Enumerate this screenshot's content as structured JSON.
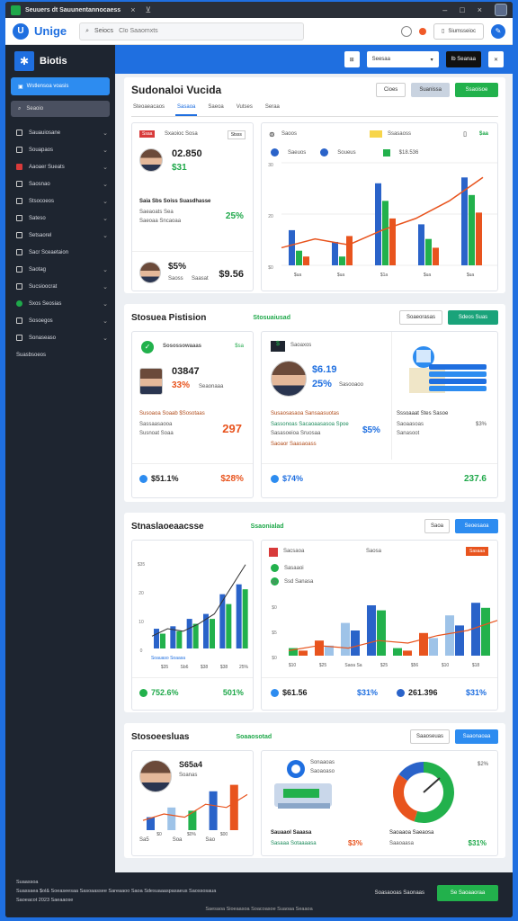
{
  "browser": {
    "tab_title": "Seuuers dt Sauunentannocaess",
    "close": "×",
    "pin": "⊻",
    "min": "–",
    "max": "□",
    "close_win": "×"
  },
  "appbar": {
    "logo": "Unige",
    "search_label": "Seiocs",
    "search_placeholder": "Clo Saaomxts",
    "user_label": "Siumsseioc"
  },
  "sidebar": {
    "brand": "Biotis",
    "active": "Wstlensoa voasis",
    "search": "Seaoio",
    "items": [
      {
        "label": "Sauauiosane",
        "icon": "doc-icon",
        "chev": true
      },
      {
        "label": "Souapaos",
        "icon": "grid-icon",
        "chev": true
      },
      {
        "label": "Aaoaer Sueats",
        "icon": "red-icon",
        "chev": true
      },
      {
        "label": "Saosnao",
        "icon": "box-icon",
        "chev": true
      },
      {
        "label": "Stsocoeos",
        "icon": "layer-icon",
        "chev": true
      },
      {
        "label": "Sateso",
        "icon": "list-icon",
        "chev": true
      },
      {
        "label": "Setsaorel",
        "icon": "chart-icon",
        "chev": true
      },
      {
        "label": "Sacr Sceaetaion",
        "icon": "user-icon",
        "chev": false
      },
      {
        "label": "Saotag",
        "icon": "clock-icon",
        "chev": true
      },
      {
        "label": "Sucsioocrat",
        "icon": "globe-icon",
        "chev": true
      },
      {
        "label": "Sxos Seosias",
        "icon": "green-icon",
        "chev": true
      },
      {
        "label": "Sosoegos",
        "icon": "link-icon",
        "chev": true
      },
      {
        "label": "Sonaseaso",
        "icon": "gear-icon",
        "chev": true
      },
      {
        "label": "Suasbsoeos",
        "icon": "",
        "chev": false
      }
    ]
  },
  "toolbar": {
    "select_label": "Seesaa",
    "dark_btn": "Ib Seanaa"
  },
  "page": {
    "title": "Sudonaloi Vucida",
    "btn_ghost": "Cioes",
    "btn_grey": "Suanissa",
    "btn_green": "Ssaoisoe",
    "tabs": [
      "Steoaeacaos",
      "Sasaoa",
      "Saeoa",
      "Vutses",
      "Seraa"
    ],
    "card1": {
      "badge": "Ssaa",
      "head": "Sxaoioc Sosa",
      "chip": "Stsss",
      "big": "02.850",
      "sub": "$31",
      "line1": "Saia Sbs Soiss Suasdhasse",
      "line2": "Saeaoats Sea",
      "line3": "Saeoaa Sncaoaa",
      "pct": "25%",
      "bottom_big": "$5%",
      "bottom_sub": "Saoss",
      "bottom_sub2": "Saasat",
      "bottom_val": "$9.56"
    },
    "card2": {
      "head": "Saoos",
      "chip": "Ssasaoss",
      "tag": "$aa",
      "legend": [
        "Saeuos",
        "Soueus",
        "$18.536"
      ],
      "yticks": [
        "30",
        "20",
        "$0"
      ],
      "xticks": [
        "$ua",
        "$ua",
        "$1a",
        "$ua",
        "$ua"
      ]
    }
  },
  "section2": {
    "title": "Stosuea Pistision",
    "tag": "Stosuaiusad",
    "btn1": "Soaeorasas",
    "btn2": "Sdeos Suas",
    "cardA": {
      "head": "Sosossowaaas",
      "tag": "$sa",
      "big": "03847",
      "pct": "33%",
      "sub": "Seaonaaa",
      "line1": "Susoaoa Soaab $Sosotaas",
      "line2": "Sassaasaooa",
      "line3": "Susnoat Soaa",
      "val": "297",
      "foot_l": "$51.1%",
      "foot_r": "$28%"
    },
    "cardB": {
      "head": "Saoaxos",
      "big": "$6.19",
      "pct": "25%",
      "sub": "Sasooaoo",
      "line1": "Susaosasaoa Sansaasuotas",
      "line2": "Sassonoas Sacaoaasasoa Spoe",
      "line3": "Sasasoeioa Sruosaa",
      "line4": "Saoaor Saasaoass",
      "pct2": "$5%",
      "foot_l": "$74%",
      "foot_r": "237.6"
    },
    "cardC": {
      "line1": "Sssoaaat Stes Sasoe",
      "line2": "Saoaasoas",
      "line3": "Sanasoot",
      "val": "$3%"
    }
  },
  "section3": {
    "title": "Stnaslaoeaacsse",
    "tag": "Ssaonialad",
    "btn1": "Saoa",
    "btn2": "Seoesaoa",
    "chartA": {
      "yticks": [
        "$35",
        "20",
        "10",
        "0"
      ],
      "xticks": [
        "$35",
        "Sb6",
        "$38",
        "$38",
        "25%"
      ],
      "label": "Soauaso Soaasa",
      "foot_l": "752.6%",
      "foot_r": "501%"
    },
    "chartB": {
      "head": "Sacsaoa",
      "head2": "Saosa",
      "chip": "Sasaaa",
      "legend": [
        "Sasaaoi",
        "Ssd Sanasa"
      ],
      "yticks": [
        "$0",
        "$0",
        "$5",
        "$0"
      ],
      "xticks": [
        "$10",
        "$25",
        "Saoa Sa",
        "$25",
        "$56",
        "$10",
        "$18"
      ],
      "foot_a": "$61.56",
      "foot_b": "$31%",
      "foot_c": "261.396",
      "foot_d": "$31%"
    }
  },
  "section4": {
    "title": "Stosoeesluas",
    "tag": "Soaaosotad",
    "btn1": "Saaoseuas",
    "btn2": "Saaonaoaa",
    "cardA": {
      "name": "S65a4",
      "sub": "Soanas",
      "xticks": [
        "$0",
        "$0%",
        "$00"
      ],
      "foot": [
        "Sa5",
        "Soa",
        "Sao"
      ]
    },
    "cardB": {
      "head": "Sonaaoas",
      "sub": "Saoaoaso",
      "line1": "Sauaaol Saaasa",
      "line2": "Sasaaa Sotaaaasa",
      "pct": "$3%",
      "line3": "Saoaaoa Saeaosa",
      "line4": "Saaoaasa",
      "tag": "$2%",
      "pct2": "$31%"
    }
  },
  "footer": {
    "lines": [
      "Suaassoa",
      "Suassaea $ol& Soeaseesaa Sasoaassee Sareaaoo Saoa Sdesuaaaspasaeus Saossosaua",
      "Saoeacot 2023 Saeaaose",
      "Sfass Soa Sanoao"
    ],
    "link": "Soasaooas Saonaas",
    "btn": "Se Saoaaoraa",
    "bottom": "Saesaoa Sioeaasoa Soacoasoe Suaoaa Seaaoa"
  },
  "colors": {
    "brand": "#1f6fe0",
    "green": "#22b14c",
    "orange": "#e8541e",
    "sidebar": "#1e2530"
  },
  "chart_data": [
    {
      "type": "bar",
      "categories": [
        "$ua",
        "$ua",
        "$1a",
        "$ua",
        "$ua"
      ],
      "series": [
        {
          "values": [
            12,
            8,
            28,
            14,
            30
          ]
        },
        {
          "values": [
            5,
            3,
            22,
            9,
            24
          ]
        },
        {
          "values": [
            3,
            10,
            16,
            6,
            18
          ]
        }
      ],
      "line": [
        6,
        9,
        7,
        12,
        16,
        22,
        30
      ],
      "ylim": [
        0,
        35
      ]
    },
    {
      "type": "bar",
      "categories": [
        "$35",
        "Sb6",
        "$38",
        "$38",
        "25%"
      ],
      "series": [
        {
          "values": [
            8,
            9,
            12,
            14,
            22,
            26
          ]
        },
        {
          "values": [
            6,
            7,
            10,
            12,
            18,
            24
          ]
        }
      ],
      "line": [
        5,
        8,
        7,
        10,
        14,
        24,
        34
      ],
      "ylim": [
        0,
        35
      ]
    },
    {
      "type": "bar",
      "categories": [
        "$10",
        "$25",
        "Saoa Sa",
        "$25",
        "$56",
        "$10",
        "$18"
      ],
      "series": [
        {
          "values": [
            3,
            6,
            13,
            20,
            3,
            9,
            16,
            21
          ]
        },
        {
          "values": [
            2,
            4,
            10,
            18,
            2,
            7,
            12,
            19
          ]
        }
      ],
      "line": [
        2,
        4,
        3,
        6,
        5,
        8,
        10,
        14
      ],
      "ylim": [
        0,
        30
      ]
    },
    {
      "type": "bar",
      "series": [
        {
          "values": [
            4,
            7,
            6,
            12,
            14
          ]
        }
      ],
      "line": [
        3,
        5,
        4,
        8,
        7,
        11
      ],
      "ylim": [
        0,
        15
      ]
    },
    {
      "type": "pie",
      "values": [
        55,
        30,
        15
      ]
    }
  ]
}
